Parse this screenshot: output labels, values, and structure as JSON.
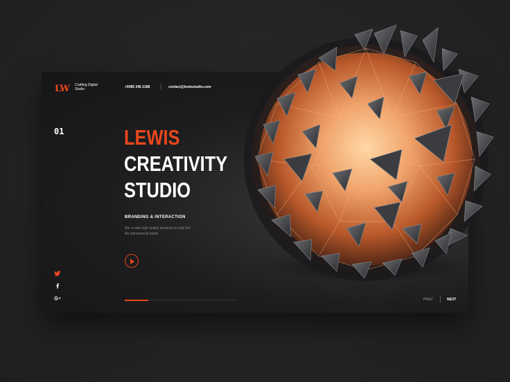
{
  "brand": {
    "logo_text": "LW",
    "tagline": "Crafting Digital Studio"
  },
  "contact": {
    "phone": "+0085 346 2188",
    "email": "contact@lewisstudio.com"
  },
  "hero": {
    "slide_number": "01",
    "title_accent": "LEWIS",
    "title_line2": "CREATIVITY",
    "title_line3": "STUDIO",
    "subtitle": "BRANDING & INTERACTION",
    "description": "We create high quality products to help the life interested & better"
  },
  "social": {
    "items": [
      "twitter-icon",
      "facebook-icon",
      "google-plus-icon"
    ],
    "glyphs": [
      "🐦",
      "f",
      "G+"
    ]
  },
  "slider": {
    "progress": 0.21,
    "prev_label": "PREV",
    "next_label": "NEXT"
  },
  "colors": {
    "accent": "#e8471c",
    "background": "#232324",
    "card": "#1b1b1d",
    "text": "#ffffff",
    "muted": "#8a8a8a"
  }
}
